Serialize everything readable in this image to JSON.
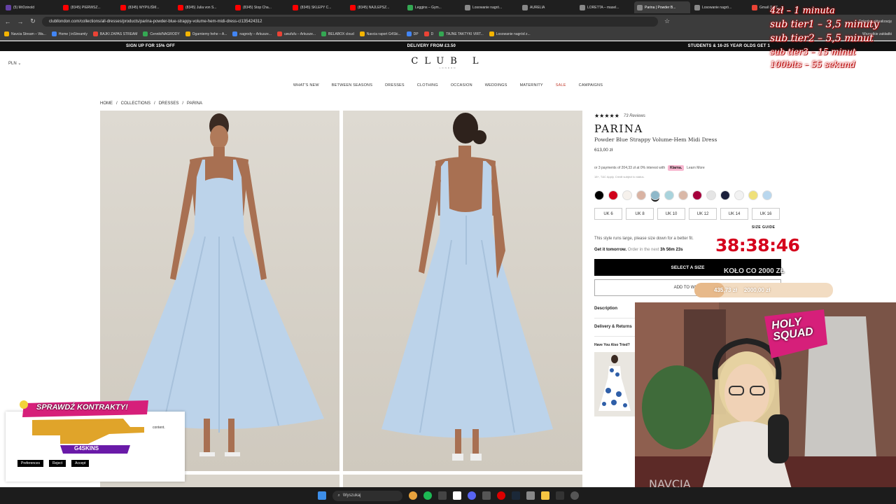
{
  "browser": {
    "tabs": [
      {
        "label": "(5) MrDzinold",
        "color": "#6441a5"
      },
      {
        "label": "(8345) PIERWSZ...",
        "color": "#ff0000"
      },
      {
        "label": "(8345) WYPILIŚM...",
        "color": "#ff0000"
      },
      {
        "label": "(8345) Julia von S...",
        "color": "#ff0000"
      },
      {
        "label": "(8345) Stop Cha...",
        "color": "#ff0000"
      },
      {
        "label": "(8345) SKLEPY C...",
        "color": "#ff0000"
      },
      {
        "label": "(8345) NAJLEPSZ...",
        "color": "#ff0000"
      },
      {
        "label": "Leggins – Gym...",
        "color": "#34a853"
      },
      {
        "label": "Losowanie nagró...",
        "color": "#888888"
      },
      {
        "label": "AURELIA",
        "color": "#888888"
      },
      {
        "label": "LORETTA – masel...",
        "color": "#888888"
      },
      {
        "label": "Parina | Powder B...",
        "color": "#888888"
      },
      {
        "label": "Losowanie nagró...",
        "color": "#888888"
      },
      {
        "label": "Gmail (1 87...",
        "color": "#ea4335"
      }
    ],
    "url": "clubllondon.com/collections/all-dresses/products/parina-powder-blue-strappy-volume-hem-midi-dress-cl135424312",
    "update_label": "Dokończ aktualizację",
    "bookmarks": [
      "Navcia Stream – Wa...",
      "Home | inStreamly",
      "BAJKI ZAPAS STREAM",
      "Cennik/NAGRODY",
      "Ogarniemy hehe – A...",
      "nagrody – Arkusze...",
      "uwufufu – Arkusze...",
      "BELABOX cloud",
      "Navcia raport G4Ski...",
      "DP",
      "D",
      "TAJNE TAKTYKI VIRT...",
      "Losowanie nagród z..."
    ],
    "all_bookmarks": "Wszystkie zakładki"
  },
  "promo": {
    "left": "SIGN UP FOR 15% OFF",
    "center": "DELIVERY FROM £3.50",
    "right": "STUDENTS & 16-25 YEAR OLDS GET 1"
  },
  "header": {
    "currency": "PLN",
    "logo": "CLUB L",
    "logo_sub": "LONDON",
    "nav": [
      "WHAT'S NEW",
      "BETWEEN SEASONS",
      "DRESSES",
      "CLOTHING",
      "OCCASION",
      "WEDDINGS",
      "MATERNITY",
      "SALE",
      "CAMPAIGNS"
    ]
  },
  "breadcrumb": [
    "HOME",
    "/",
    "COLLECTIONS",
    "/",
    "DRESSES",
    "/",
    "PARINA"
  ],
  "product": {
    "stars": "★★★★★",
    "reviews": "73 Reviews",
    "name": "PARINA",
    "subtitle": "Powder Blue Strappy Volume-Hem Midi Dress",
    "price": "613,00 zł",
    "installments": "or 3 payments of 204,33 zł at 0% interest with",
    "klarna": "Klarna.",
    "learn_more": "Learn More",
    "small_note": "18+, T&C Apply. Credit subject to status.",
    "swatches": [
      "#000000",
      "#d0021b",
      "#f6f1ec",
      "#d9b3a3",
      "#8fb8c9",
      "#a9d3dc",
      "#d9b8a8",
      "#a6003c",
      "#e5e5e5",
      "#1a1f3a",
      "#f2f2f2",
      "#efe07a",
      "#b9d7ee"
    ],
    "sizes": [
      "UK 6",
      "UK 8",
      "UK 10",
      "UK 12",
      "UK 14",
      "UK 16"
    ],
    "size_guide": "SIZE GUIDE",
    "fit_note": "This style runs large, please size down for a better fit.",
    "tomorrow_prefix": "Get it tomorrow.",
    "tomorrow_middle": "Order in the next",
    "tomorrow_time": "3h 56m 23s",
    "select_size": "SELECT A SIZE",
    "add_wishlist": "ADD TO WISH",
    "accordions": [
      "Description",
      "Delivery & Returns",
      "Have You Also Tried?"
    ]
  },
  "cookie": {
    "text": "content.",
    "preferences": "Preferences",
    "reject": "Reject",
    "accept": "Accept"
  },
  "stream_overlay": {
    "rates": [
      "4zł – 1 minuta",
      "sub tier1 – 3,5 minuty",
      "sub tier2 – 5,5 minut",
      "sub tier3 – 15 minut",
      "100bits – 55 sekund"
    ],
    "timer": "38:38:46",
    "goal_label": "KOŁO CO 2000 ZŁ",
    "goal_current": "435,73 zł",
    "goal_target": "2000,00 zł",
    "goal_progress": 0.218,
    "g4_headline": "SPRAWDŹ KONTRAKTY!",
    "g4_brand": "G4SKINS",
    "webcam_badge": "HOLY SQUAD",
    "webcam_name": "NAVCIA"
  },
  "taskbar": {
    "search": "Wyszukaj"
  }
}
